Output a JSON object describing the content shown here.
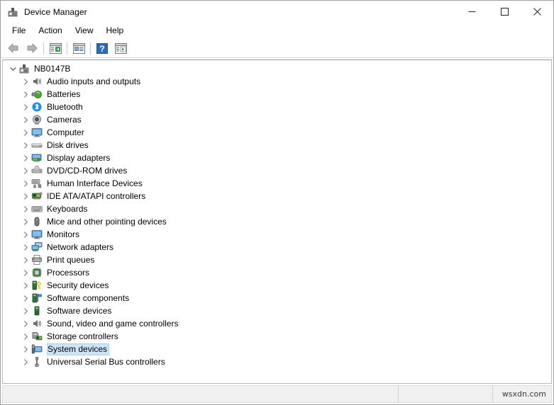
{
  "window": {
    "title": "Device Manager",
    "title_icon": "device-manager-icon"
  },
  "caption": {
    "minimize": "minimize-icon",
    "maximize": "maximize-icon",
    "close": "close-icon"
  },
  "menubar": {
    "items": [
      {
        "label": "File"
      },
      {
        "label": "Action"
      },
      {
        "label": "View"
      },
      {
        "label": "Help"
      }
    ]
  },
  "toolbar": {
    "buttons": [
      {
        "name": "back-arrow-icon",
        "enabled": false
      },
      {
        "name": "forward-arrow-icon",
        "enabled": false
      },
      {
        "name": "show-hide-console-tree-icon",
        "enabled": true
      },
      {
        "name": "properties-icon",
        "enabled": true
      },
      {
        "name": "help-icon",
        "enabled": true
      },
      {
        "name": "scan-for-hardware-changes-icon",
        "enabled": true
      }
    ]
  },
  "tree": {
    "root": {
      "label": "NB0147B",
      "icon": "computer-root-icon",
      "expanded": true
    },
    "items": [
      {
        "label": "Audio inputs and outputs",
        "icon": "speaker-icon"
      },
      {
        "label": "Batteries",
        "icon": "battery-icon"
      },
      {
        "label": "Bluetooth",
        "icon": "bluetooth-icon"
      },
      {
        "label": "Cameras",
        "icon": "camera-icon"
      },
      {
        "label": "Computer",
        "icon": "monitor-icon"
      },
      {
        "label": "Disk drives",
        "icon": "disk-drive-icon"
      },
      {
        "label": "Display adapters",
        "icon": "display-adapter-icon"
      },
      {
        "label": "DVD/CD-ROM drives",
        "icon": "dvd-drive-icon"
      },
      {
        "label": "Human Interface Devices",
        "icon": "hid-icon"
      },
      {
        "label": "IDE ATA/ATAPI controllers",
        "icon": "ide-controller-icon"
      },
      {
        "label": "Keyboards",
        "icon": "keyboard-icon"
      },
      {
        "label": "Mice and other pointing devices",
        "icon": "mouse-icon"
      },
      {
        "label": "Monitors",
        "icon": "monitor-icon"
      },
      {
        "label": "Network adapters",
        "icon": "network-adapter-icon"
      },
      {
        "label": "Print queues",
        "icon": "printer-icon"
      },
      {
        "label": "Processors",
        "icon": "processor-icon"
      },
      {
        "label": "Security devices",
        "icon": "security-device-icon"
      },
      {
        "label": "Software components",
        "icon": "software-component-icon"
      },
      {
        "label": "Software devices",
        "icon": "software-device-icon"
      },
      {
        "label": "Sound, video and game controllers",
        "icon": "speaker-icon"
      },
      {
        "label": "Storage controllers",
        "icon": "storage-controller-icon"
      },
      {
        "label": "System devices",
        "icon": "system-device-icon",
        "selected": true
      },
      {
        "label": "Universal Serial Bus controllers",
        "icon": "usb-icon"
      }
    ]
  },
  "statusbar": {
    "watermark": "wsxdn.com"
  },
  "colors": {
    "selection_fill": "#cce4f7",
    "selection_border": "#a9d2f3",
    "window_bg": "#ffffff",
    "statusbar_bg": "#f0f0f0"
  }
}
